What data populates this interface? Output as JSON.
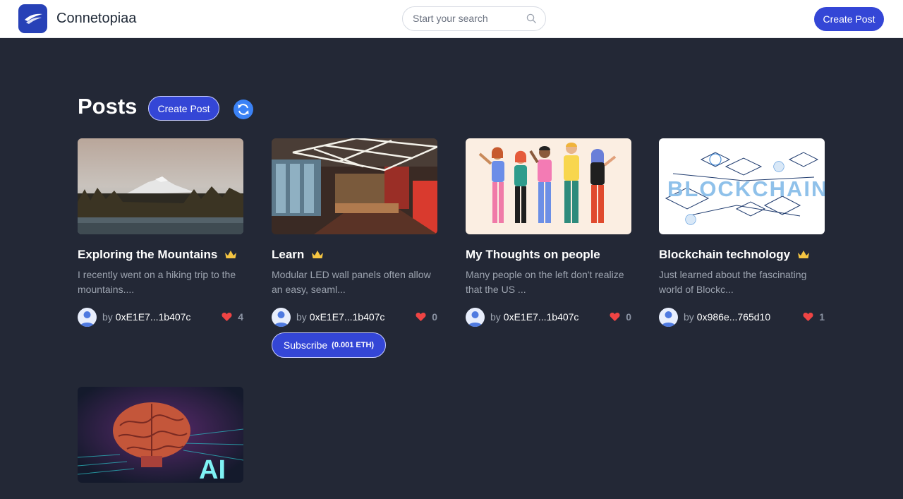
{
  "header": {
    "brand": "Connetopiaa",
    "search_placeholder": "Start your search",
    "create_label": "Create Post"
  },
  "main": {
    "title": "Posts",
    "create_label": "Create Post",
    "posts": [
      {
        "title": "Exploring the Mountains",
        "premium": true,
        "excerpt": "I recently went on a hiking trip to the mountains....",
        "by": "by",
        "author": "0xE1E7...1b407c",
        "likes": "4"
      },
      {
        "title": "Learn",
        "premium": true,
        "excerpt": "Modular LED wall panels often allow an easy, seaml...",
        "by": "by",
        "author": "0xE1E7...1b407c",
        "likes": "0",
        "subscribe_label": "Subscribe",
        "subscribe_price": "(0.001 ETH)"
      },
      {
        "title": "My Thoughts on people",
        "premium": false,
        "excerpt": "Many people on the left don't realize that the US ...",
        "by": "by",
        "author": "0xE1E7...1b407c",
        "likes": "0"
      },
      {
        "title": "Blockchain technology",
        "premium": true,
        "excerpt": "Just learned about the fascinating world of Blockc...",
        "by": "by",
        "author": "0x986e...765d10",
        "likes": "1"
      },
      {
        "image_text": "AI"
      }
    ]
  },
  "colors": {
    "background": "#232836",
    "accent": "#3446d6",
    "heart": "#ef4444",
    "crown": "#f5c542"
  }
}
